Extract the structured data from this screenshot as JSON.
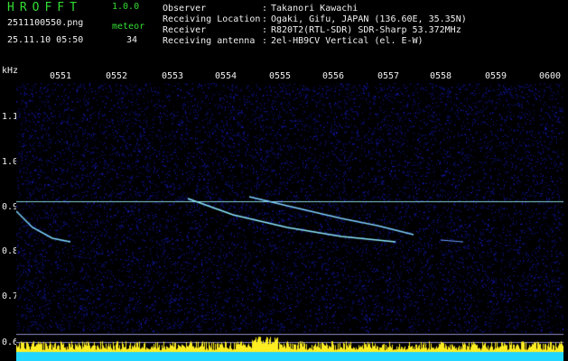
{
  "app": {
    "title": "HROFFT",
    "version": "1.0.0"
  },
  "file": {
    "name": "2511100550.png",
    "timestamp": "25.11.10 05:50"
  },
  "meteor": {
    "label": "meteor",
    "count": "34"
  },
  "info": [
    {
      "key": "Observer",
      "value": "Takanori Kawachi"
    },
    {
      "key": "Receiving Location",
      "value": "Ogaki, Gifu, JAPAN (136.60E, 35.35N)"
    },
    {
      "key": "Receiver",
      "value": "R820T2(RTL-SDR) SDR-Sharp 53.372MHz"
    },
    {
      "key": "Receiving antenna",
      "value": "2el-HB9CV Vertical (el. E-W)"
    }
  ],
  "axis": {
    "unit": "kHz",
    "time_ticks": [
      "0551",
      "0552",
      "0553",
      "0554",
      "0555",
      "0556",
      "0557",
      "0558",
      "0559",
      "0600"
    ],
    "freq_ticks": [
      "1.1",
      "1.0",
      "0.9",
      "0.8",
      "0.7",
      "0.6"
    ]
  },
  "colors": {
    "label_green": "#33dd33",
    "text_white": "#f0f0f0",
    "background": "#000000",
    "noise_blue": "#1a1aa8",
    "carrier_cyan": "#9ff4ff",
    "level_yellow": "#ffee22",
    "level_cyan": "#22d6ff"
  }
}
